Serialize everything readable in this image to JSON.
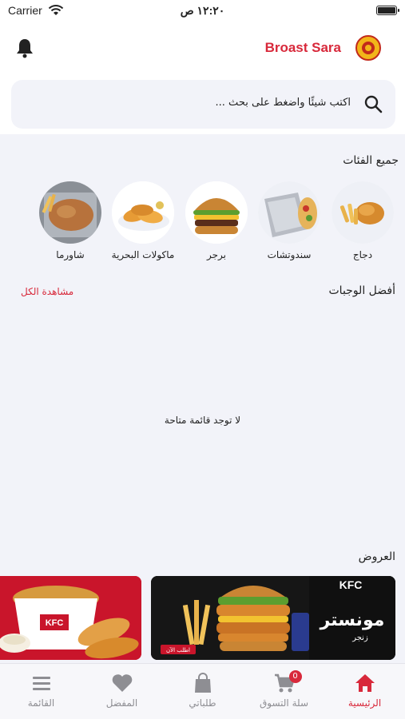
{
  "status": {
    "carrier": "Carrier",
    "time": "١٢:٢٠ ص"
  },
  "header": {
    "brand": "Broast Sara"
  },
  "search": {
    "placeholder": "اكتب شيئًا واضغط على بحث ..."
  },
  "categories": {
    "title": "جميع الفئات",
    "items": [
      {
        "label": "دجاج",
        "icon": "chicken-image"
      },
      {
        "label": "سندوتشات",
        "icon": "sandwich-image"
      },
      {
        "label": "برجر",
        "icon": "burger-image"
      },
      {
        "label": "ماكولات البحرية",
        "icon": "seafood-image"
      },
      {
        "label": "شاورما",
        "icon": "shawarma-image"
      }
    ]
  },
  "meals": {
    "title": "أفضل الوجبات",
    "see_all": "مشاهدة الكل",
    "empty": "لا توجد قائمة متاحة"
  },
  "offers": {
    "title": "العروض",
    "banner1": {
      "brand": "KFC",
      "headline": "مونستر",
      "sub": "زنجر",
      "cta": "اطلب الآن"
    },
    "banner2": {
      "brand": "KFC"
    }
  },
  "tabs": [
    {
      "label": "الرئيسية",
      "icon": "home-icon",
      "active": true
    },
    {
      "label": "سلة التسوق",
      "icon": "cart-icon",
      "badge": "0"
    },
    {
      "label": "طلباتي",
      "icon": "bag-icon"
    },
    {
      "label": "المفضل",
      "icon": "heart-icon"
    },
    {
      "label": "القائمة",
      "icon": "menu-icon"
    }
  ],
  "colors": {
    "accent": "#d8293b",
    "background": "#f2f3f9",
    "inactive": "#8e8e93"
  }
}
